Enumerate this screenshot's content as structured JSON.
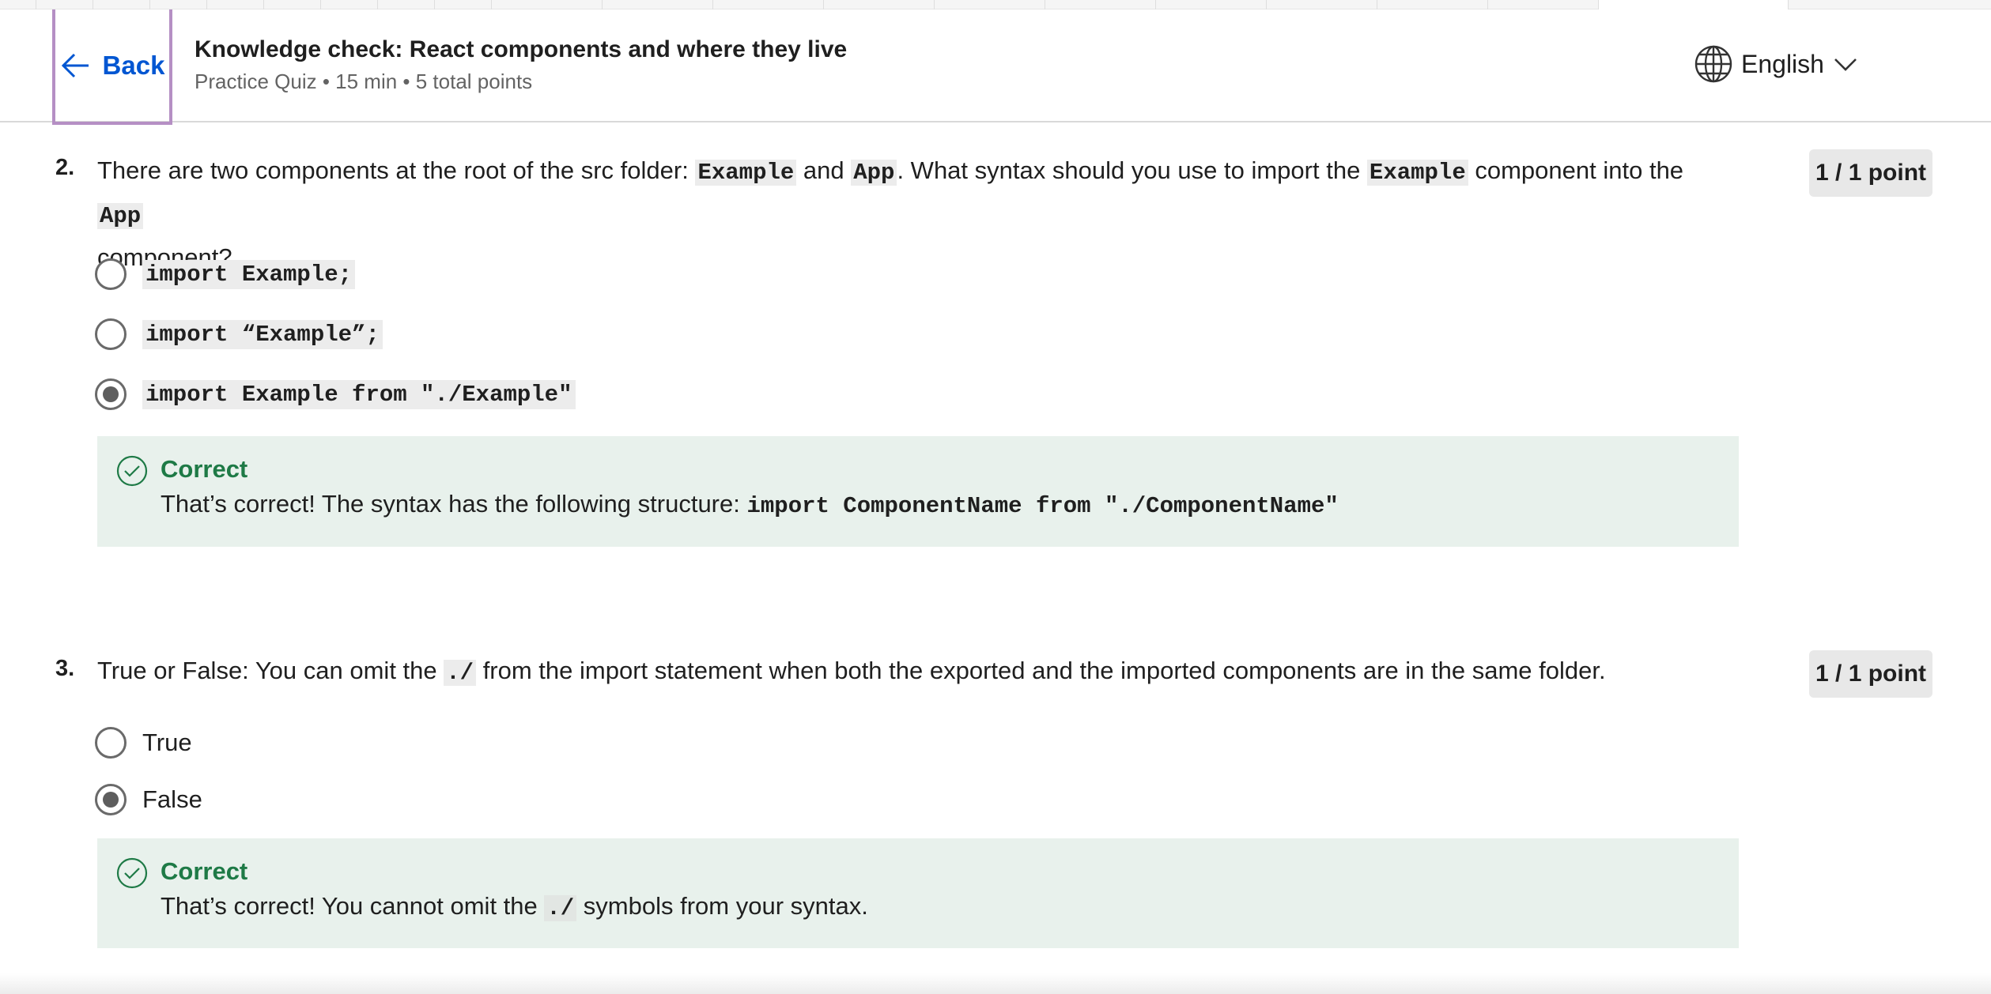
{
  "header": {
    "back_label": "Back",
    "title": "Knowledge check: React components and where they live",
    "meta": "Practice Quiz • 15 min • 5 total points",
    "language": "English"
  },
  "questions": [
    {
      "number": "2.",
      "points": "1 / 1 point",
      "text_parts": [
        "There are two components at the root of the src folder: ",
        "Example",
        " and ",
        "App",
        ". What syntax should you use to import the ",
        "Example",
        " component into the ",
        "App"
      ],
      "text_line2": "component?",
      "options": [
        {
          "label": "import Example;",
          "selected": false
        },
        {
          "label": "import “Example”;",
          "selected": false
        },
        {
          "label": "import Example from \"./Example\"",
          "selected": true
        }
      ],
      "feedback": {
        "title": "Correct",
        "text_prefix": "That’s correct! The syntax has the following structure: ",
        "code": "import ComponentName from \"./ComponentName\""
      }
    },
    {
      "number": "3.",
      "points": "1 / 1 point",
      "text_prefix": "True or False: You can omit the ",
      "text_code": "./",
      "text_suffix": " from the import statement when both the exported and the imported components are in the same folder.",
      "options": [
        {
          "label": "True",
          "selected": false
        },
        {
          "label": "False",
          "selected": true
        }
      ],
      "feedback": {
        "title": "Correct",
        "text_prefix": "That’s correct! You cannot omit the ",
        "code": "./",
        "text_suffix": " symbols from your syntax."
      }
    }
  ],
  "icons": {
    "back": "arrow-left-icon",
    "language": "globe-icon",
    "dropdown": "chevron-down-icon",
    "correct": "check-circle-icon"
  },
  "colors": {
    "accent": "#0056d2",
    "correct_green": "#1e7a46",
    "feedback_bg": "#e8f1ec",
    "back_outline": "#b58fc4"
  }
}
